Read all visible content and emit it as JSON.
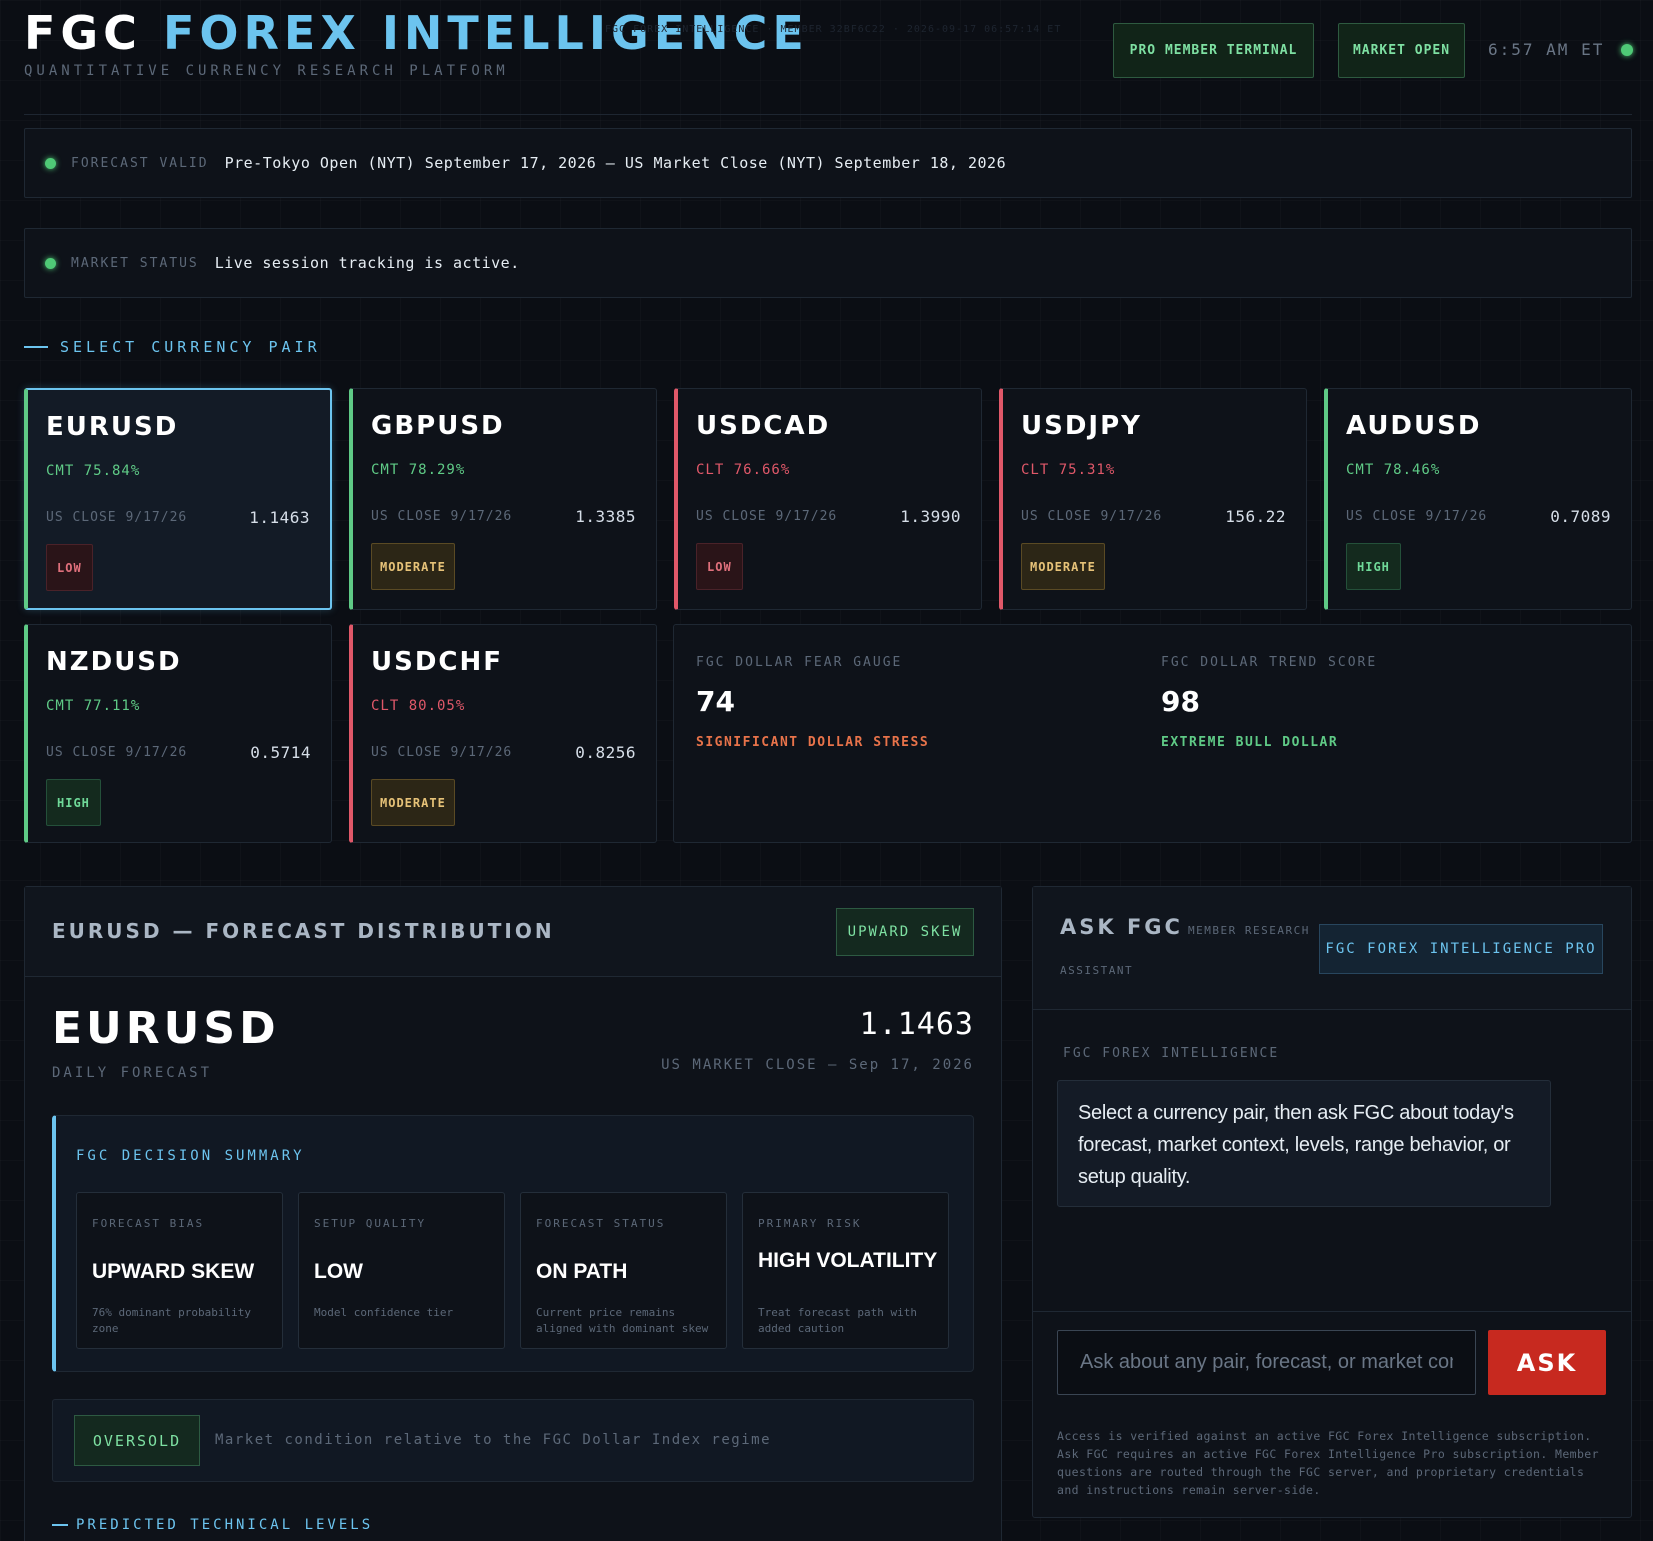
{
  "header": {
    "brand_main": "FGC",
    "brand_accent": "FOREX INTELLIGENCE",
    "tagline": "QUANTITATIVE CURRENCY RESEARCH PLATFORM",
    "pro_badge": "PRO MEMBER TERMINAL",
    "market_badge": "MARKET OPEN",
    "time": "6:57 AM ET"
  },
  "forecast_bar": {
    "label": "FORECAST VALID",
    "value": "Pre-Tokyo Open (NYT) September 17, 2026 — US Market Close (NYT) September 18, 2026"
  },
  "status_bar": {
    "label": "MARKET STATUS",
    "value": "Live session tracking is active."
  },
  "pair_section": {
    "title": "SELECT CURRENCY PAIR"
  },
  "pairs": [
    {
      "symbol": "EURUSD",
      "cm": "CMT 75.84%",
      "close_label": "US CLOSE 9/17/26",
      "close": "1.1463",
      "quality": "LOW",
      "direction": "up"
    },
    {
      "symbol": "GBPUSD",
      "cm": "CMT 78.29%",
      "close_label": "US CLOSE 9/17/26",
      "close": "1.3385",
      "quality": "MODERATE",
      "direction": "up"
    },
    {
      "symbol": "USDCAD",
      "cm": "CLT 76.66%",
      "close_label": "US CLOSE 9/17/26",
      "close": "1.3990",
      "quality": "LOW",
      "direction": "down"
    },
    {
      "symbol": "USDJPY",
      "cm": "CLT 75.31%",
      "close_label": "US CLOSE 9/17/26",
      "close": "156.22",
      "quality": "MODERATE",
      "direction": "down"
    },
    {
      "symbol": "AUDUSD",
      "cm": "CMT 78.46%",
      "close_label": "US CLOSE 9/17/26",
      "close": "0.7089",
      "quality": "HIGH",
      "direction": "up"
    },
    {
      "symbol": "NZDUSD",
      "cm": "CMT 77.11%",
      "close_label": "US CLOSE 9/17/26",
      "close": "0.5714",
      "quality": "HIGH",
      "direction": "up"
    },
    {
      "symbol": "USDCHF",
      "cm": "CLT 80.05%",
      "close_label": "US CLOSE 9/17/26",
      "close": "0.8256",
      "quality": "MODERATE",
      "direction": "down"
    }
  ],
  "fear_gauge": {
    "label": "FGC DOLLAR FEAR GAUGE",
    "value": "74",
    "status": "SIGNIFICANT DOLLAR STRESS",
    "color": "#e8734a"
  },
  "trend_score": {
    "label": "FGC DOLLAR TREND SCORE",
    "value": "98",
    "status": "EXTREME BULL DOLLAR",
    "color": "#5fca86"
  },
  "forecast": {
    "title": "EURUSD — FORECAST DISTRIBUTION",
    "skew_badge": "UPWARD SKEW",
    "symbol": "EURUSD",
    "subtitle": "DAILY FORECAST",
    "price": "1.1463",
    "close_label": "US MARKET CLOSE — Sep 17, 2026",
    "summary_title": "FGC DECISION SUMMARY",
    "summary": [
      {
        "label": "FORECAST BIAS",
        "value": "UPWARD SKEW",
        "sub": "76% dominant probability zone"
      },
      {
        "label": "SETUP QUALITY",
        "value": "LOW",
        "sub": "Model confidence tier"
      },
      {
        "label": "FORECAST STATUS",
        "value": "ON PATH",
        "sub": "Current price remains aligned with dominant skew"
      },
      {
        "label": "PRIMARY RISK",
        "value": "HIGH VOLATILITY",
        "sub": "Treat forecast path with added caution"
      }
    ],
    "condition_tag": "OVERSOLD",
    "condition_text": "Market condition relative to the FGC Dollar Index regime",
    "levels_title": "PREDICTED TECHNICAL LEVELS"
  },
  "ask": {
    "title": "ASK FGC",
    "sub1": "MEMBER RESEARCH",
    "sub2": "ASSISTANT",
    "pro_badge": "FGC FOREX INTELLIGENCE PRO",
    "msg_label": "FGC FOREX INTELLIGENCE",
    "message": "Select a currency pair, then ask FGC about today's forecast, market context, levels, range behavior, or setup quality.",
    "input_placeholder": "Ask about any pair, forecast, or market conditions",
    "button": "ASK",
    "note": "Access is verified against an active FGC Forex Intelligence subscription. Ask FGC requires an active FGC Forex Intelligence Pro subscription. Member questions are routed through the FGC server, and proprietary credentials and instructions remain server-side."
  },
  "watermark": "FGC FOREX INTELLIGENCE · MEMBER 32BF6C22 · 2026-09-17 06:57:14 ET"
}
